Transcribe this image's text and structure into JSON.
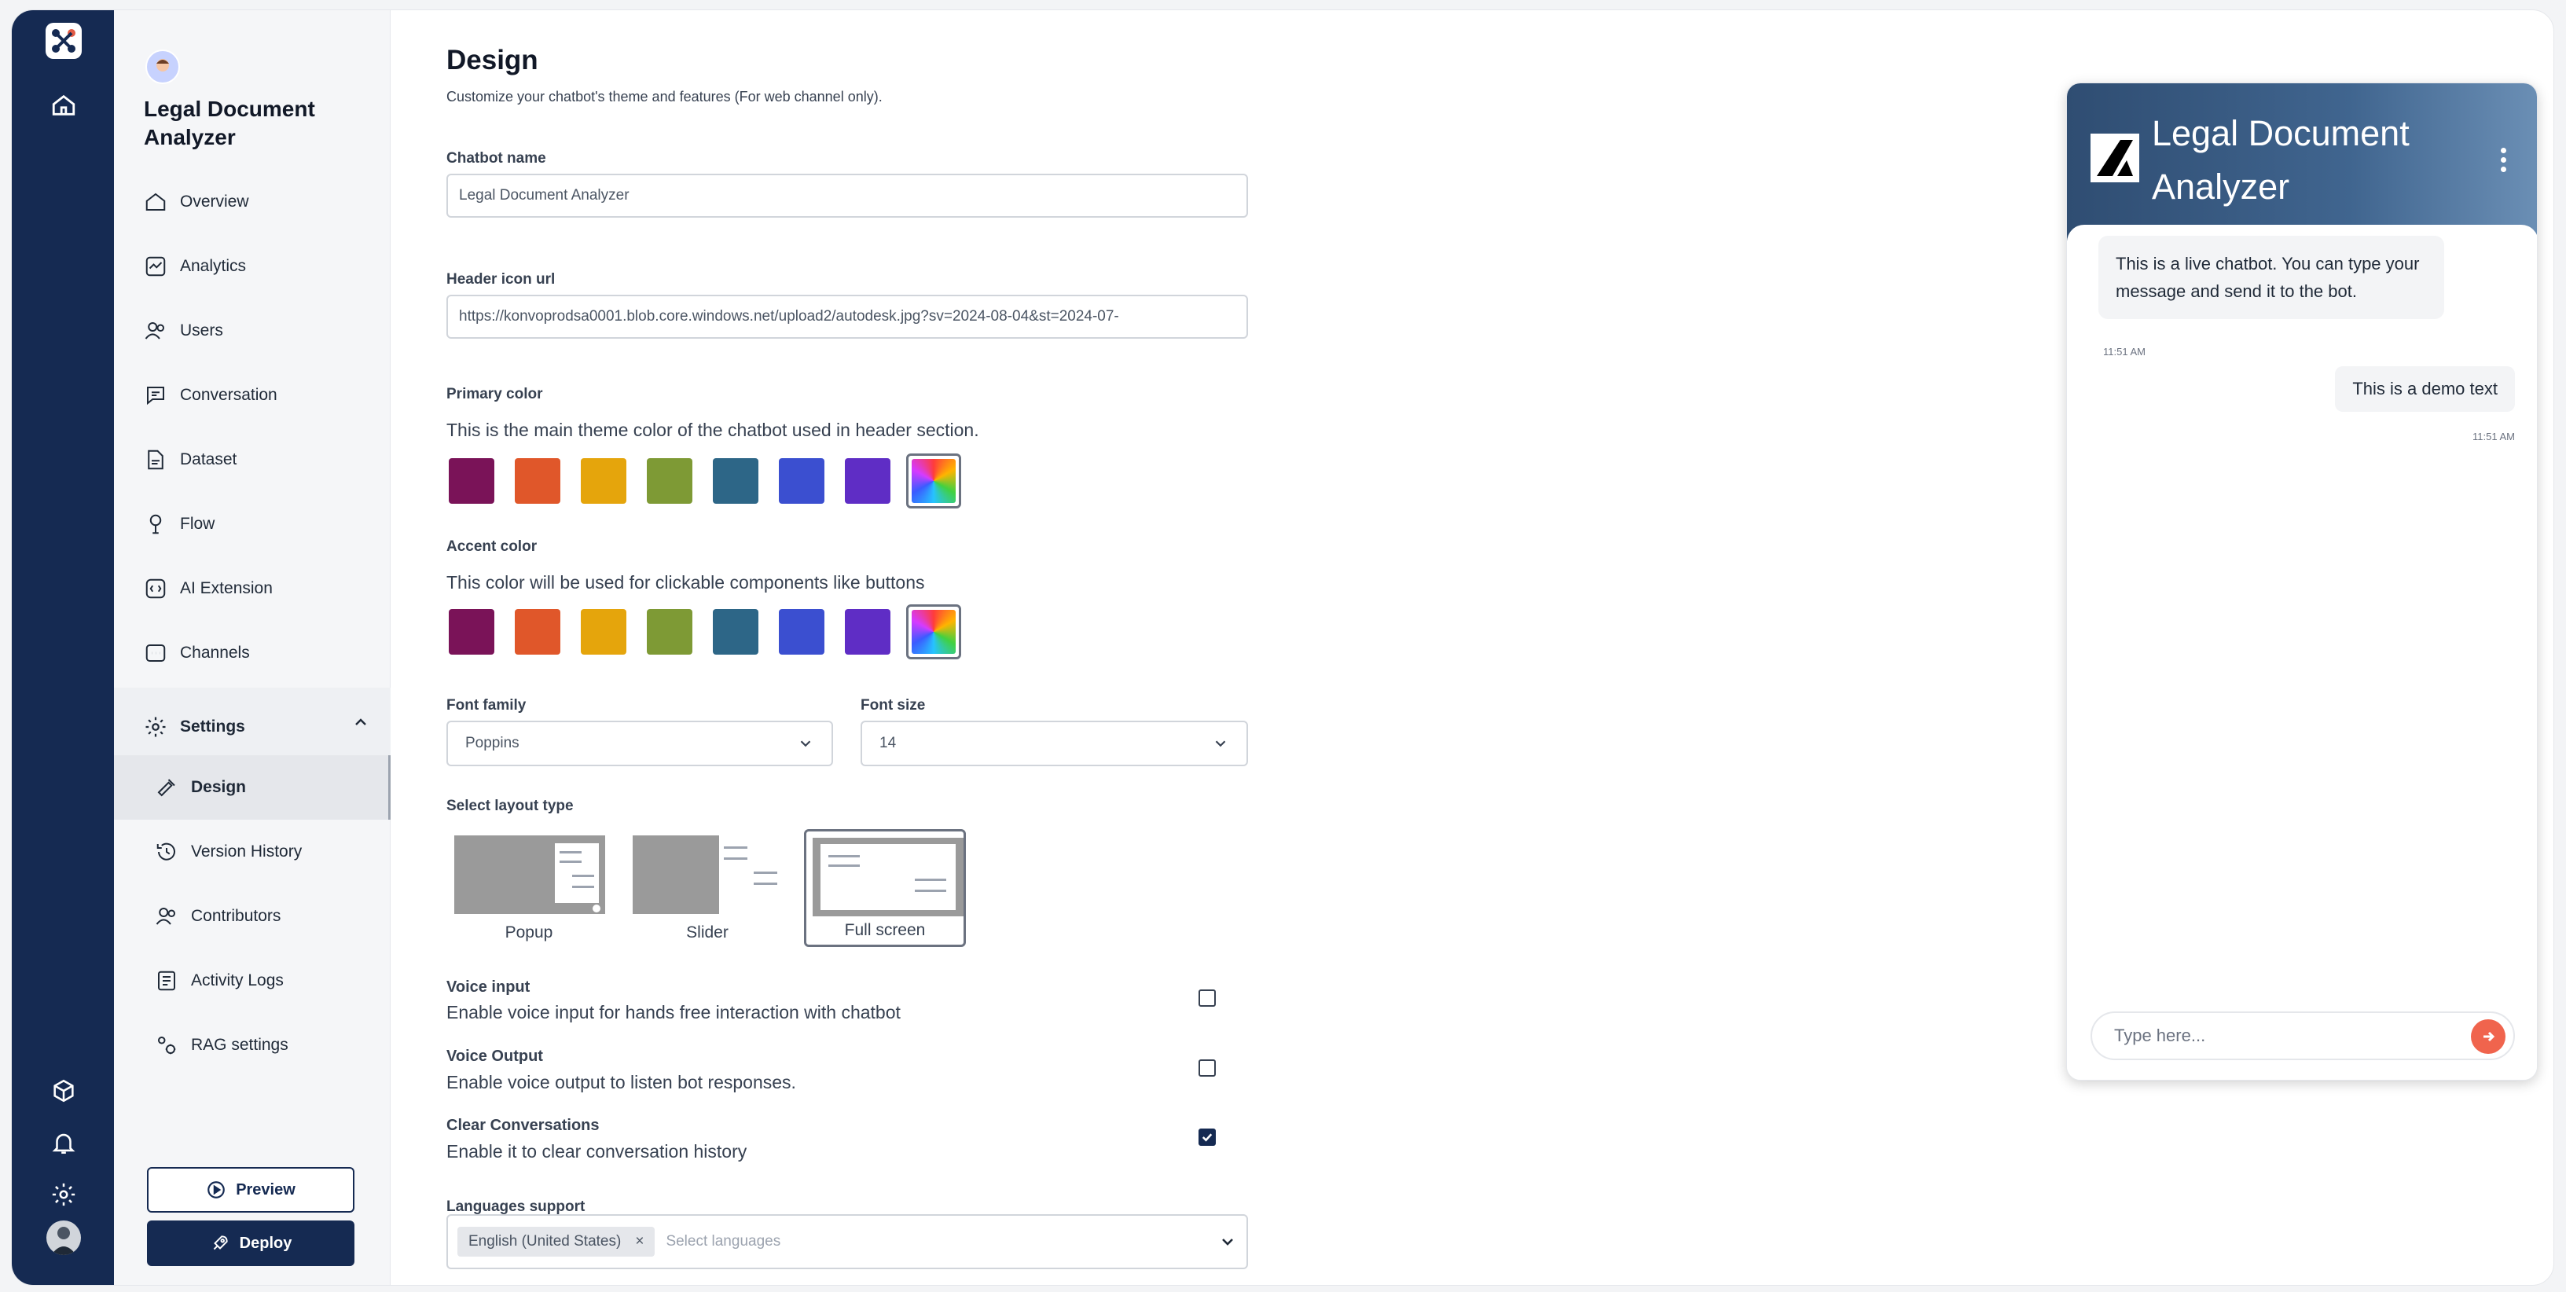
{
  "app": {
    "title": "Legal Document Analyzer"
  },
  "sidebar": {
    "title": "Legal Document Analyzer",
    "items": [
      {
        "label": "Overview",
        "icon": "home-icon"
      },
      {
        "label": "Analytics",
        "icon": "analytics-icon"
      },
      {
        "label": "Users",
        "icon": "users-icon"
      },
      {
        "label": "Conversation",
        "icon": "chat-icon"
      },
      {
        "label": "Dataset",
        "icon": "file-icon"
      },
      {
        "label": "Flow",
        "icon": "flow-icon"
      },
      {
        "label": "AI Extension",
        "icon": "extension-icon"
      },
      {
        "label": "Channels",
        "icon": "channels-icon"
      }
    ],
    "settings": {
      "label": "Settings",
      "items": [
        {
          "label": "Design",
          "icon": "design-icon"
        },
        {
          "label": "Version History",
          "icon": "history-icon"
        },
        {
          "label": "Contributors",
          "icon": "contributors-icon"
        },
        {
          "label": "Activity Logs",
          "icon": "logs-icon"
        },
        {
          "label": "RAG settings",
          "icon": "rag-icon"
        }
      ]
    },
    "preview_label": "Preview",
    "deploy_label": "Deploy"
  },
  "page": {
    "title": "Design",
    "subtitle": "Customize your chatbot's theme and features (For web channel only).",
    "chatbot_name": {
      "label": "Chatbot name",
      "value": "Legal Document Analyzer"
    },
    "header_icon": {
      "label": "Header icon url",
      "value": "https://konvoprodsa0001.blob.core.windows.net/upload2/autodesk.jpg?sv=2024-08-04&st=2024-07-"
    },
    "primary_color": {
      "label": "Primary color",
      "description": "This is the main theme color of the chatbot used in header section.",
      "swatches": [
        "#7a1358",
        "#e0572a",
        "#e5a50c",
        "#7e9a35",
        "#2d6687",
        "#3b4fd0",
        "#5f2dc5"
      ],
      "custom_selected": true
    },
    "accent_color": {
      "label": "Accent color",
      "description": "This color will be used for clickable components like buttons",
      "swatches": [
        "#7a1358",
        "#e0572a",
        "#e5a50c",
        "#7e9a35",
        "#2d6687",
        "#3b4fd0",
        "#5f2dc5"
      ],
      "custom_selected": true
    },
    "font_family": {
      "label": "Font family",
      "value": "Poppins"
    },
    "font_size": {
      "label": "Font size",
      "value": "14"
    },
    "layout": {
      "label": "Select layout type",
      "options": [
        "Popup",
        "Slider",
        "Full screen"
      ],
      "selected": "Full screen"
    },
    "voice_input": {
      "title": "Voice input",
      "description": "Enable voice input for hands free interaction with chatbot",
      "checked": false
    },
    "voice_output": {
      "title": "Voice Output",
      "description": "Enable voice output to listen bot responses.",
      "checked": false
    },
    "clear_conversations": {
      "title": "Clear Conversations",
      "description": "Enable it to clear conversation history",
      "checked": true
    },
    "languages": {
      "label": "Languages support",
      "chip": "English (United States)",
      "chip_remove": "×",
      "placeholder": "Select languages"
    }
  },
  "chat_preview": {
    "title": "Legal Document Analyzer",
    "bot_message": "This is a live chatbot. You can type your message and send it to the bot.",
    "bot_time": "11:51 AM",
    "user_message": "This is a demo text",
    "user_time": "11:51 AM",
    "input_placeholder": "Type here..."
  }
}
